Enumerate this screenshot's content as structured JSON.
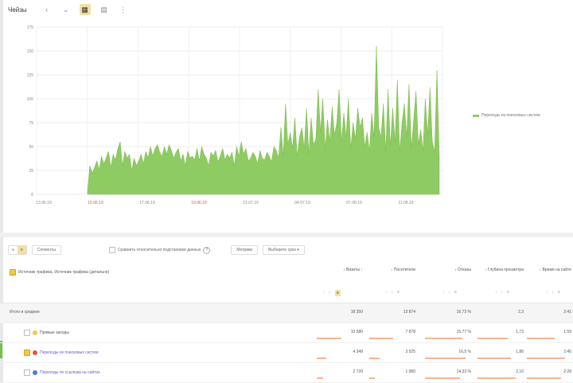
{
  "toolbar": {
    "title": "Чейзы",
    "icons": [
      "back-icon",
      "chevron-icon",
      "area-chart-icon",
      "grid-icon",
      "list-icon"
    ]
  },
  "chart_data": {
    "type": "area",
    "title": "",
    "xlabel": "",
    "ylabel": "",
    "ylim": [
      0,
      175
    ],
    "y_ticks": [
      "175",
      "150",
      "125",
      "100",
      "75",
      "50",
      "25",
      "0"
    ],
    "x_ticks": [
      {
        "label": "13.06.19",
        "weekend": false
      },
      {
        "label": "15.06.19",
        "weekend": true
      },
      {
        "label": "17.06.19",
        "weekend": false
      },
      {
        "label": "19.06.19",
        "weekend": true
      },
      {
        "label": "21.07.19",
        "weekend": false
      },
      {
        "label": "04.07.19",
        "weekend": false
      },
      {
        "label": "07.08.19",
        "weekend": false
      },
      {
        "label": "11.08.19",
        "weekend": false
      }
    ],
    "series": [
      {
        "name": "Переходы из поисковых систем",
        "color": "#8fcb63",
        "values": [
          3,
          30,
          22,
          28,
          35,
          26,
          40,
          32,
          38,
          45,
          28,
          42,
          36,
          48,
          55,
          30,
          45,
          38,
          42,
          25,
          38,
          30,
          35,
          42,
          32,
          45,
          38,
          50,
          40,
          48,
          52,
          44,
          40,
          50,
          42,
          52,
          46,
          38,
          44,
          48,
          35,
          42,
          30,
          45,
          38,
          40,
          36,
          48,
          35,
          50,
          42,
          38,
          30,
          44,
          40,
          46,
          34,
          40,
          48,
          36,
          42,
          38,
          44,
          30,
          50,
          40,
          55,
          42,
          48,
          35,
          38,
          44,
          40,
          32,
          46,
          38,
          36,
          44,
          40,
          34,
          50,
          46,
          38,
          70,
          40,
          95,
          52,
          65,
          48,
          80,
          40,
          60,
          70,
          48,
          90,
          42,
          80,
          52,
          58,
          110,
          65,
          100,
          48,
          78,
          55,
          92,
          62,
          75,
          110,
          55,
          85,
          60,
          100,
          48,
          75,
          58,
          90,
          70,
          80,
          50,
          65,
          45,
          85,
          60,
          155,
          70,
          60,
          95,
          45,
          110,
          50,
          90,
          55,
          120,
          45,
          75,
          95,
          60,
          115,
          48,
          78,
          108,
          52,
          68,
          45,
          100,
          62,
          112,
          55,
          45,
          130,
          40
        ]
      }
    ],
    "grid": true,
    "legend_position": "right"
  },
  "controls": {
    "segment_left": "≡",
    "segment_right": "≡",
    "compare_button": "Сегменты",
    "checkbox_label": "Сравнить относительно подстановки данных",
    "checkbox_checked": false,
    "hint": "?",
    "metrics_button": "Метрики",
    "grouping_button": "Выберите срез ▾"
  },
  "table": {
    "dimension_header": "Источник трафика, Источник трафика (детально)",
    "columns": [
      {
        "label": "↓ Визиты ↑",
        "sort": [
          "↑",
          "↓",
          "≡"
        ]
      },
      {
        "label": "↓ Посетители",
        "sort": [
          "↑",
          "↓",
          "≡"
        ]
      },
      {
        "label": "↓ Отказы",
        "sort": [
          "↑",
          "↓",
          "≡"
        ]
      },
      {
        "label": "↓ Глубина просмотра",
        "sort": [
          "↑",
          "↓",
          "≡"
        ]
      },
      {
        "label": "↓ Время на сайте",
        "sort": [
          "↑",
          "↓",
          "≡"
        ]
      }
    ],
    "total": {
      "label": "Итого и средние",
      "values": [
        "18 350",
        "13 874",
        "16,73 %",
        "2,3",
        "2:41"
      ]
    },
    "rows": [
      {
        "label": "Прямые заходы",
        "icon_color": "#f2c94c",
        "values": [
          "10 580",
          "7 878",
          "15,77 %",
          "1,73",
          "1:59"
        ],
        "bars": [
          0.6,
          0.57,
          0.9,
          0.74,
          0.7
        ]
      },
      {
        "label": "Переходы из поисковых систем",
        "icon_color": "#e0533d",
        "values": [
          "4 348",
          "3 525",
          "16,5 %",
          "1,86",
          "2:45"
        ],
        "bars": [
          0.24,
          0.25,
          0.98,
          0.8,
          0.96
        ]
      },
      {
        "label": "Переходы по ссылкам на сайтах",
        "icon_color": "#4a7dd9",
        "values": [
          "2 720",
          "1 980",
          "14,33 %",
          "2,16",
          "2:28"
        ],
        "bars": [
          0.15,
          0.14,
          0.85,
          0.92,
          0.86
        ]
      }
    ]
  }
}
